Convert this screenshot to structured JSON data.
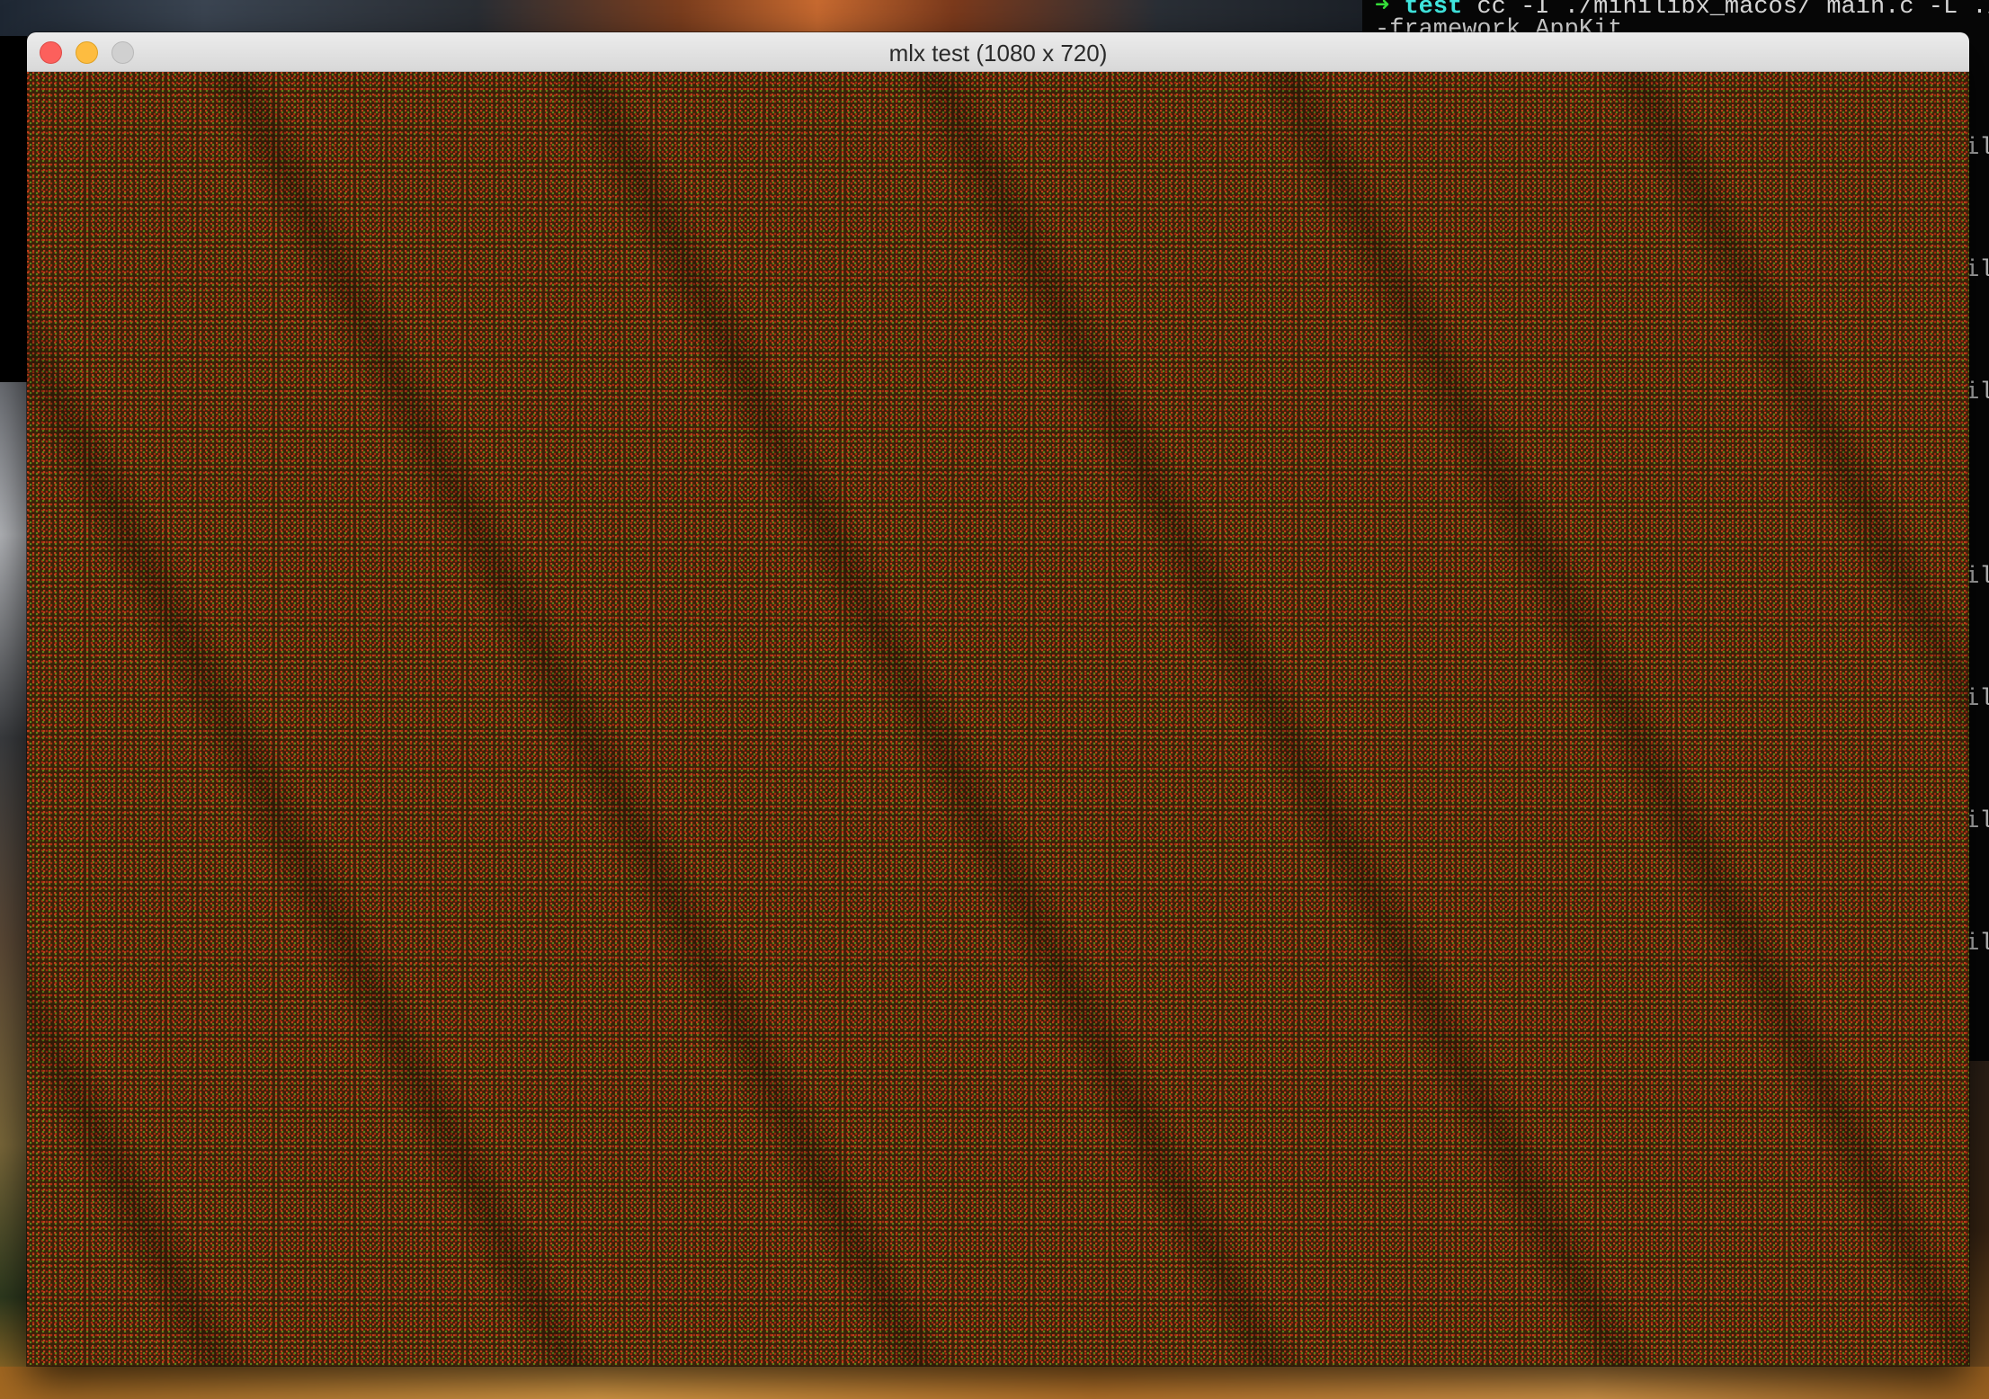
{
  "window": {
    "title": "mlx test (1080 x 720)",
    "buttons": [
      "close",
      "minimize",
      "zoom"
    ]
  },
  "terminal": {
    "prompt_symbol": "➜",
    "directory": "test",
    "command_line_1": " cc -I ./minilibx_macos/ main.c -L ./minil",
    "command_line_2": "-framework AppKit",
    "edge_fragments": [
      "il",
      "il",
      "il",
      "il",
      "il",
      "il",
      "il"
    ]
  },
  "colors": {
    "close": "#fc605c",
    "minimize": "#fdbc40",
    "zoom_inactive": "#d0d0d0",
    "canvas_base": "#3a2108"
  }
}
